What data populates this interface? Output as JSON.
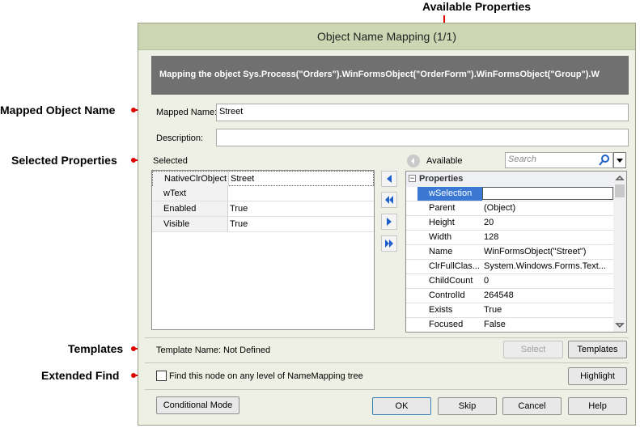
{
  "callouts": {
    "available_properties": "Available Properties",
    "mapped_object_name": "Mapped Object Name",
    "selected_properties": "Selected Properties",
    "templates": "Templates",
    "extended_find": "Extended Find"
  },
  "dialog": {
    "title": "Object Name Mapping (1/1)",
    "banner": "Mapping the object Sys.Process(\"Orders\").WinFormsObject(\"OrderForm\").WinFormsObject(\"Group\").W"
  },
  "form": {
    "mapped_name_label": "Mapped Name:",
    "mapped_name_value": "Street",
    "description_label": "Description:",
    "description_value": "",
    "selected_label": "Selected",
    "available_label": "Available",
    "search_placeholder": "Search"
  },
  "selected_rows": [
    {
      "name": "NativeClrObject",
      "value": "Street"
    },
    {
      "name": "wText",
      "value": ""
    },
    {
      "name": "Enabled",
      "value": "True"
    },
    {
      "name": "Visible",
      "value": "True"
    }
  ],
  "available": {
    "group": "Properties",
    "rows": [
      {
        "name": "wSelection",
        "value": ""
      },
      {
        "name": "Parent",
        "value": "(Object)"
      },
      {
        "name": "Height",
        "value": "20"
      },
      {
        "name": "Width",
        "value": "128"
      },
      {
        "name": "Name",
        "value": "WinFormsObject(\"Street\")"
      },
      {
        "name": "ClrFullClas...",
        "value": "System.Windows.Forms.Text..."
      },
      {
        "name": "ChildCount",
        "value": "0"
      },
      {
        "name": "ControlId",
        "value": "264548"
      },
      {
        "name": "Exists",
        "value": "True"
      },
      {
        "name": "Focused",
        "value": "False"
      }
    ]
  },
  "template": {
    "label": "Template Name:",
    "value": "Not Defined",
    "select_button": "Select",
    "templates_button": "Templates"
  },
  "extended": {
    "checkbox_label": "Find this node on any level of NameMapping tree",
    "checked": false,
    "highlight_button": "Highlight"
  },
  "footer": {
    "conditional_mode": "Conditional Mode",
    "ok": "OK",
    "skip": "Skip",
    "cancel": "Cancel",
    "help": "Help"
  },
  "colors": {
    "callout_line": "#e00000",
    "title_bar": "#cdd6b3",
    "dialog_bg": "#eef0e6",
    "banner_bg": "#707070",
    "selection": "#3a78d4"
  },
  "icons": [
    "move-left-icon",
    "move-all-left-icon",
    "move-right-icon",
    "move-all-right-icon",
    "back-icon",
    "search-icon",
    "dropdown-icon",
    "collapse-icon"
  ]
}
